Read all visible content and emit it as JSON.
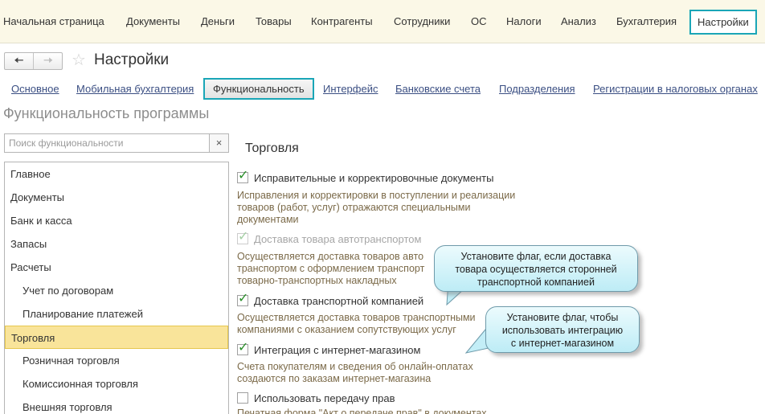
{
  "top_menu": [
    {
      "label": "Начальная страница",
      "active": false
    },
    {
      "label": "Документы",
      "active": false
    },
    {
      "label": "Деньги",
      "active": false
    },
    {
      "label": "Товары",
      "active": false
    },
    {
      "label": "Контрагенты",
      "active": false
    },
    {
      "label": "Сотрудники",
      "active": false
    },
    {
      "label": "ОС",
      "active": false
    },
    {
      "label": "Налоги",
      "active": false
    },
    {
      "label": "Анализ",
      "active": false
    },
    {
      "label": "Бухгалтерия",
      "active": false
    },
    {
      "label": "Настройки",
      "active": true
    }
  ],
  "nav": {
    "back_icon": "arrow-left-icon",
    "forward_icon": "arrow-right-icon",
    "favorite_icon": "star-icon"
  },
  "window_title": "Настройки",
  "tabs": [
    {
      "label": "Основное",
      "active": false
    },
    {
      "label": "Мобильная бухгалтерия",
      "active": false
    },
    {
      "label": "Функциональность",
      "active": true
    },
    {
      "label": "Интерфейс",
      "active": false
    },
    {
      "label": "Банковские счета",
      "active": false
    },
    {
      "label": "Подразделения",
      "active": false
    },
    {
      "label": "Регистрации в налоговых органах",
      "active": false
    }
  ],
  "section_title": "Функциональность программы",
  "search": {
    "placeholder": "Поиск функциональности",
    "value": "",
    "clear_label": "×"
  },
  "sections_list": [
    {
      "label": "Главное",
      "level": 0,
      "selected": false
    },
    {
      "label": "Документы",
      "level": 0,
      "selected": false
    },
    {
      "label": "Банк и касса",
      "level": 0,
      "selected": false
    },
    {
      "label": "Запасы",
      "level": 0,
      "selected": false
    },
    {
      "label": "Расчеты",
      "level": 0,
      "selected": false
    },
    {
      "label": "Учет по договорам",
      "level": 1,
      "selected": false
    },
    {
      "label": "Планирование платежей",
      "level": 1,
      "selected": false
    },
    {
      "label": "Торговля",
      "level": 0,
      "selected": true
    },
    {
      "label": "Розничная торговля",
      "level": 1,
      "selected": false
    },
    {
      "label": "Комиссионная торговля",
      "level": 1,
      "selected": false
    },
    {
      "label": "Внешняя торговля",
      "level": 1,
      "selected": false
    }
  ],
  "content": {
    "heading": "Торговля",
    "options": [
      {
        "label": "Исправительные и корректировочные документы",
        "checked": true,
        "disabled": false,
        "description": [
          "Исправления и корректировки в поступлении и реализации",
          "товаров (работ, услуг) отражаются специальными",
          "документами"
        ]
      },
      {
        "label": "Доставка товара автотранспортом",
        "checked": true,
        "disabled": true,
        "description": [
          "Осуществляется доставка товаров авто",
          "транспортом с оформлением транспорт",
          "товарно-транспортных накладных"
        ]
      },
      {
        "label": "Доставка транспортной компанией",
        "checked": true,
        "disabled": false,
        "description": [
          "Осуществляется доставка товаров транспортными",
          "компаниями с оказанием сопутствующих услуг"
        ]
      },
      {
        "label": "Интеграция с интернет-магазином",
        "checked": true,
        "disabled": false,
        "description": [
          "Счета покупателям и сведения об онлайн-оплатах",
          "создаются по заказам интернет-магазина"
        ]
      },
      {
        "label": "Использовать передачу прав",
        "checked": false,
        "disabled": false,
        "description": [
          "Печатная форма \"Акт о передаче прав\" в документах"
        ]
      }
    ]
  },
  "callouts": [
    {
      "lines": [
        "Установите флаг, если доставка",
        "товара осуществляется сторонней",
        "транспортной компанией"
      ]
    },
    {
      "lines": [
        "Установите флаг, чтобы",
        "использовать интеграцию",
        "с интернет-магазином"
      ]
    }
  ]
}
